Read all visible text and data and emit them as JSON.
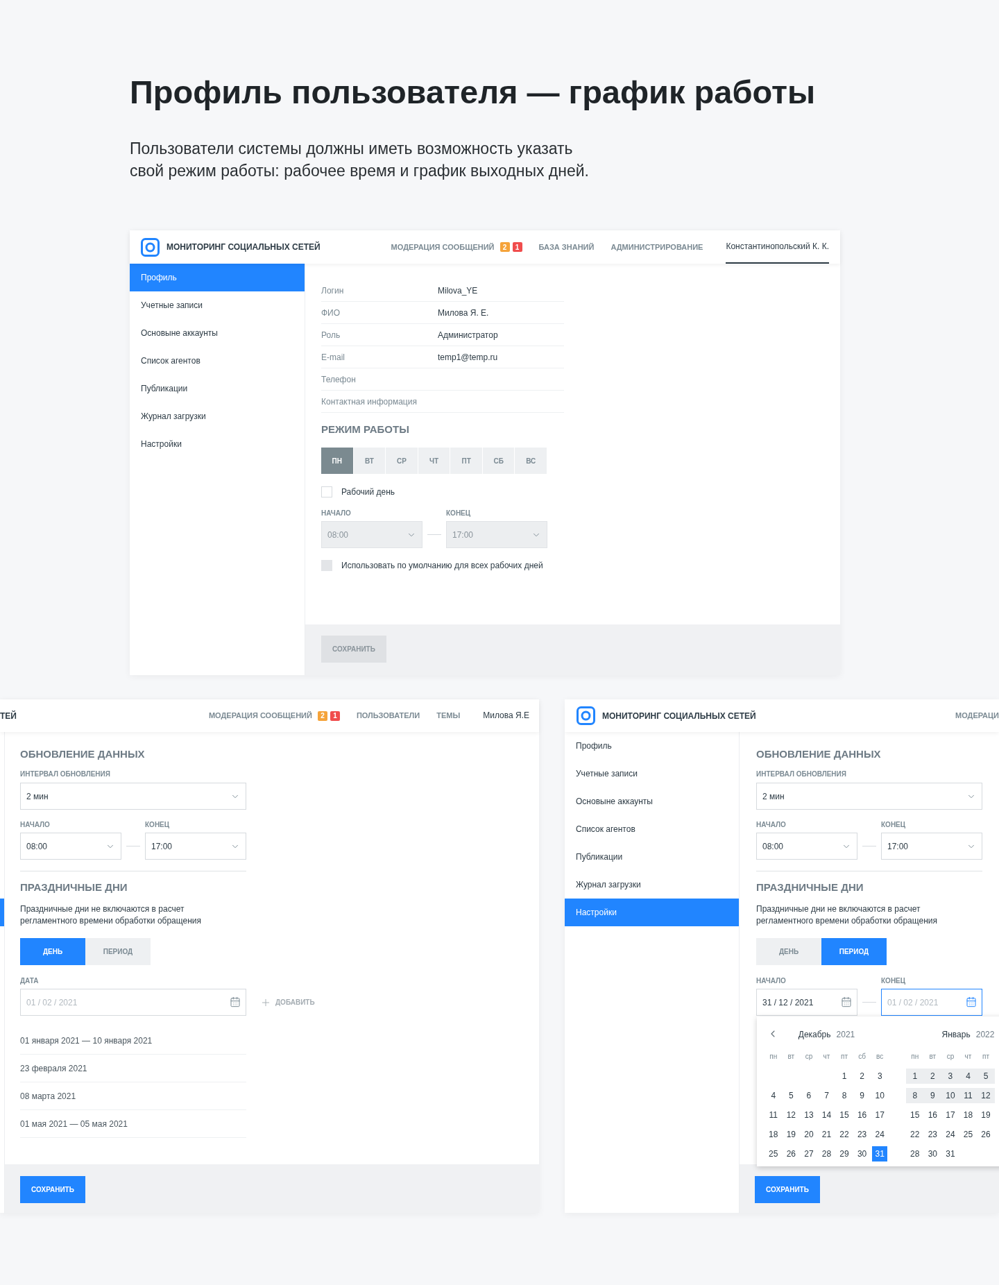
{
  "page": {
    "title": "Профиль пользователя — график работы",
    "description_lines": [
      "Пользователи системы должны иметь возможность указать",
      "свой режим работы: рабочее время и график выходных дней."
    ]
  },
  "profile_screen": {
    "header": {
      "app_title": "МОНИТОРИНГ СОЦИАЛЬНЫХ СЕТЕЙ",
      "nav": [
        {
          "label": "МОДЕРАЦИЯ СООБЩЕНИЙ",
          "badges": [
            {
              "text": "2",
              "color": "#f5a33a"
            },
            {
              "text": "1",
              "color": "#f04d4d"
            }
          ]
        },
        {
          "label": "БАЗА ЗНАНИЙ"
        },
        {
          "label": "АДМИНИСТРИРОВАНИЕ"
        }
      ],
      "user": {
        "label": "Константинопольский К. К.",
        "selected": true
      }
    },
    "sidebar": [
      {
        "label": "Профиль",
        "selected": true
      },
      {
        "label": "Учетные записи",
        "selected": false
      },
      {
        "label": "Основыне аккаунты",
        "selected": false
      },
      {
        "label": "Список агентов",
        "selected": false
      },
      {
        "label": "Публикации",
        "selected": false
      },
      {
        "label": "Журнал загрузки",
        "selected": false
      },
      {
        "label": "Настройки",
        "selected": false
      }
    ],
    "fields": [
      {
        "label": "Логин",
        "value": "Milova_YE"
      },
      {
        "label": "ФИО",
        "value": "Милова Я. Е."
      },
      {
        "label": "Роль",
        "value": "Администратор"
      },
      {
        "label": "E-mail",
        "value": "temp1@temp.ru"
      },
      {
        "label": "Телефон"
      },
      {
        "label": "Контактная информация"
      }
    ],
    "schedule": {
      "title": "РЕЖИМ РАБОТЫ",
      "days": [
        {
          "label": "ПН",
          "selected": true
        },
        {
          "label": "ВТ",
          "selected": false
        },
        {
          "label": "СР",
          "selected": false
        },
        {
          "label": "ЧТ",
          "selected": false
        },
        {
          "label": "ПТ",
          "selected": false
        },
        {
          "label": "СБ",
          "selected": false
        },
        {
          "label": "ВС",
          "selected": false
        }
      ],
      "working_day": {
        "label": "Рабочий день",
        "checked": false
      },
      "start": {
        "label": "НАЧАЛО",
        "value": "08:00",
        "disabled": true
      },
      "end": {
        "label": "КОНЕЦ",
        "value": "17:00",
        "disabled": true
      },
      "use_default": {
        "label": "Использовать по умолчанию для всех рабочих дней",
        "checked": false,
        "disabled": true
      }
    },
    "save_button": {
      "label": "СОХРАНИТЬ",
      "disabled": true
    }
  },
  "settings_left": {
    "header": {
      "app_title_fragment": "ТЕЙ",
      "nav": [
        {
          "label": "МОДЕРАЦИЯ СООБЩЕНИЙ",
          "badges": [
            {
              "text": "2",
              "color": "#f5a33a"
            },
            {
              "text": "1",
              "color": "#f04d4d"
            }
          ]
        },
        {
          "label": "ПОЛЬЗОВАТЕЛИ"
        },
        {
          "label": "ТЕМЫ"
        }
      ],
      "user": {
        "label": "Милова Я.Е",
        "selected": false
      }
    },
    "sidebar_edge": [
      {
        "selected": false
      },
      {
        "selected": false
      },
      {
        "selected": false
      },
      {
        "selected": false
      },
      {
        "selected": false
      },
      {
        "selected": false
      },
      {
        "selected": true
      }
    ],
    "update": {
      "title": "ОБНОВЛЕНИЕ ДАННЫХ",
      "interval": {
        "label": "ИНТЕРВАЛ ОБНОВЛЕНИЯ",
        "value": "2 мин"
      },
      "start": {
        "label": "НАЧАЛО",
        "value": "08:00"
      },
      "end": {
        "label": "КОНЕЦ",
        "value": "17:00"
      }
    },
    "holidays": {
      "title": "ПРАЗДНИЧНЫЕ ДНИ",
      "note_lines": [
        "Праздничные дни не включаются в расчет",
        "регламентного времени обработки обращения"
      ],
      "modes": [
        {
          "label": "ДЕНЬ",
          "selected": true
        },
        {
          "label": "ПЕРИОД",
          "selected": false
        }
      ],
      "date": {
        "label": "ДАТА",
        "placeholder": "01 / 02 / 2021"
      },
      "add": {
        "label": "ДОБАВИТЬ",
        "disabled": true
      },
      "dates": [
        "01 января 2021 — 10 января 2021",
        "23 февраля 2021",
        "08 марта 2021",
        "01 мая 2021 — 05 мая 2021"
      ]
    },
    "save_button": {
      "label": "СОХРАНИТЬ",
      "disabled": false
    }
  },
  "settings_right": {
    "header": {
      "app_title": "МОНИТОРИНГ СОЦИАЛЬНЫХ СЕТЕЙ",
      "nav_fragment": "МОДЕРАЦИ"
    },
    "sidebar": [
      {
        "label": "Профиль",
        "selected": false
      },
      {
        "label": "Учетные записи",
        "selected": false
      },
      {
        "label": "Основыне аккаунты",
        "selected": false
      },
      {
        "label": "Список агентов",
        "selected": false
      },
      {
        "label": "Публикации",
        "selected": false
      },
      {
        "label": "Журнал загрузки",
        "selected": false
      },
      {
        "label": "Настройки",
        "selected": true
      }
    ],
    "update": {
      "title": "ОБНОВЛЕНИЕ ДАННЫХ",
      "interval": {
        "label": "ИНТЕРВАЛ ОБНОВЛЕНИЯ",
        "value": "2 мин"
      },
      "start": {
        "label": "НАЧАЛО",
        "value": "08:00"
      },
      "end": {
        "label": "КОНЕЦ",
        "value": "17:00"
      }
    },
    "holidays": {
      "title": "ПРАЗДНИЧНЫЕ ДНИ",
      "note_lines": [
        "Праздничные дни не включаются в расчет",
        "регламентного времени обработки обращения"
      ],
      "modes": [
        {
          "label": "ДЕНЬ",
          "selected": false
        },
        {
          "label": "ПЕРИОД",
          "selected": true
        }
      ],
      "start": {
        "label": "НАЧАЛО",
        "value": "31 / 12 / 2021"
      },
      "end": {
        "label": "КОНЕЦ",
        "placeholder": "01 / 02 / 2021",
        "focused": true
      }
    },
    "calendar": {
      "months": [
        {
          "name": "Декабрь",
          "year": "2021",
          "prev_arrow": true,
          "weekdays": [
            "пн",
            "вт",
            "ср",
            "чт",
            "пт",
            "сб",
            "вс"
          ],
          "weeks": [
            {
              "highlighted": false,
              "right_aligned": true,
              "days": [
                {
                  "day": "1",
                  "selected": false
                },
                {
                  "day": "2",
                  "selected": false
                },
                {
                  "day": "3",
                  "selected": false
                }
              ]
            },
            {
              "highlighted": false,
              "days": [
                {
                  "day": "4",
                  "selected": false
                },
                {
                  "day": "5",
                  "selected": false
                },
                {
                  "day": "6",
                  "selected": false
                },
                {
                  "day": "7",
                  "selected": false
                },
                {
                  "day": "8",
                  "selected": false
                },
                {
                  "day": "9",
                  "selected": false
                },
                {
                  "day": "10",
                  "selected": false
                }
              ]
            },
            {
              "highlighted": false,
              "days": [
                {
                  "day": "11",
                  "selected": false
                },
                {
                  "day": "12",
                  "selected": false
                },
                {
                  "day": "13",
                  "selected": false
                },
                {
                  "day": "14",
                  "selected": false
                },
                {
                  "day": "15",
                  "selected": false
                },
                {
                  "day": "16",
                  "selected": false
                },
                {
                  "day": "17",
                  "selected": false
                }
              ]
            },
            {
              "highlighted": false,
              "days": [
                {
                  "day": "18",
                  "selected": false
                },
                {
                  "day": "19",
                  "selected": false
                },
                {
                  "day": "20",
                  "selected": false
                },
                {
                  "day": "21",
                  "selected": false
                },
                {
                  "day": "22",
                  "selected": false
                },
                {
                  "day": "23",
                  "selected": false
                },
                {
                  "day": "24",
                  "selected": false
                }
              ]
            },
            {
              "highlighted": false,
              "days": [
                {
                  "day": "25",
                  "selected": false
                },
                {
                  "day": "26",
                  "selected": false
                },
                {
                  "day": "27",
                  "selected": false
                },
                {
                  "day": "28",
                  "selected": false
                },
                {
                  "day": "29",
                  "selected": false
                },
                {
                  "day": "30",
                  "selected": false
                },
                {
                  "day": "31",
                  "selected": true
                }
              ]
            }
          ]
        },
        {
          "name": "Январь",
          "year": "2022",
          "prev_arrow": false,
          "weekdays": [
            "пн",
            "вт",
            "ср",
            "чт",
            "пт"
          ],
          "weeks": [
            {
              "highlighted": true,
              "days": [
                {
                  "day": "1",
                  "selected": false
                },
                {
                  "day": "2",
                  "selected": false
                },
                {
                  "day": "3",
                  "selected": false
                },
                {
                  "day": "4",
                  "selected": false
                },
                {
                  "day": "5",
                  "selected": false
                }
              ]
            },
            {
              "highlighted": true,
              "days": [
                {
                  "day": "8",
                  "selected": false
                },
                {
                  "day": "9",
                  "selected": false
                },
                {
                  "day": "10",
                  "selected": false
                },
                {
                  "day": "11",
                  "selected": false
                },
                {
                  "day": "12",
                  "selected": false
                }
              ]
            },
            {
              "highlighted": false,
              "days": [
                {
                  "day": "15",
                  "selected": false
                },
                {
                  "day": "16",
                  "selected": false
                },
                {
                  "day": "17",
                  "selected": false
                },
                {
                  "day": "18",
                  "selected": false
                },
                {
                  "day": "19",
                  "selected": false
                }
              ]
            },
            {
              "highlighted": false,
              "days": [
                {
                  "day": "22",
                  "selected": false
                },
                {
                  "day": "23",
                  "selected": false
                },
                {
                  "day": "24",
                  "selected": false
                },
                {
                  "day": "25",
                  "selected": false
                },
                {
                  "day": "26",
                  "selected": false
                }
              ]
            },
            {
              "highlighted": false,
              "right_aligned": false,
              "days": [
                {
                  "day": "28",
                  "selected": false
                },
                {
                  "day": "30",
                  "selected": false
                },
                {
                  "day": "31",
                  "selected": false
                }
              ]
            }
          ]
        }
      ]
    },
    "save_button": {
      "label": "СОХРАНИТЬ",
      "disabled": false
    }
  }
}
